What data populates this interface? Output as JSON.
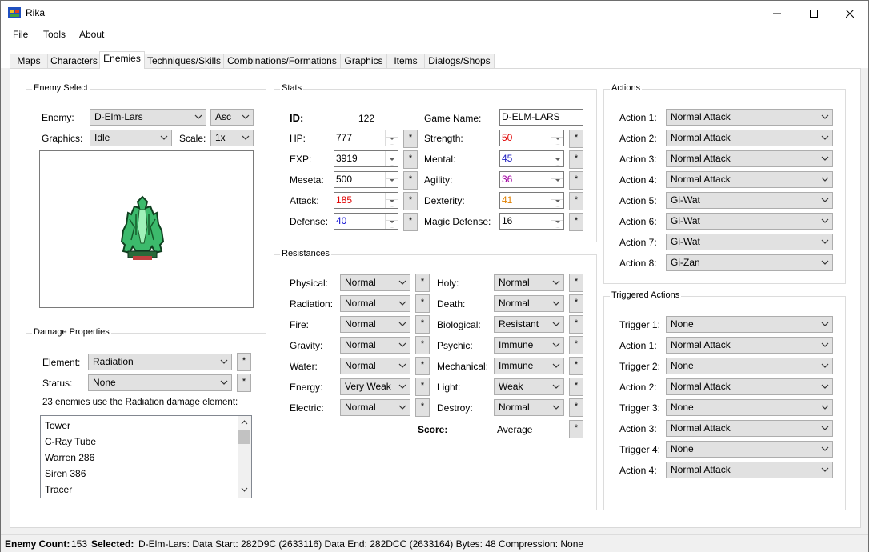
{
  "window": {
    "title": "Rika"
  },
  "menu": [
    "File",
    "Tools",
    "About"
  ],
  "tabs": [
    "Maps",
    "Characters",
    "Enemies",
    "Techniques/Skills",
    "Combinations/Formations",
    "Graphics",
    "Items",
    "Dialogs/Shops"
  ],
  "active_tab": "Enemies",
  "enemy_select": {
    "title": "Enemy Select",
    "enemy_label": "Enemy:",
    "enemy_value": "D-Elm-Lars",
    "sort_value": "Asc",
    "graphics_label": "Graphics:",
    "graphics_value": "Idle",
    "scale_label": "Scale:",
    "scale_value": "1x"
  },
  "damage": {
    "title": "Damage Properties",
    "element_label": "Element:",
    "element_value": "Radiation",
    "status_label": "Status:",
    "status_value": "None",
    "info": "23 enemies use the Radiation damage element:",
    "list": [
      "Tower",
      "C-Ray Tube",
      "Warren 286",
      "Siren 386",
      "Tracer"
    ]
  },
  "stats": {
    "title": "Stats",
    "id_label": "ID:",
    "id_value": "122",
    "game_name_label": "Game Name:",
    "game_name_value": "D-ELM-LARS",
    "left": [
      {
        "label": "HP:",
        "value": "777",
        "color": "#000000"
      },
      {
        "label": "EXP:",
        "value": "3919",
        "color": "#000000"
      },
      {
        "label": "Meseta:",
        "value": "500",
        "color": "#000000"
      },
      {
        "label": "Attack:",
        "value": "185",
        "color": "#e00000"
      },
      {
        "label": "Defense:",
        "value": "40",
        "color": "#0000d0"
      }
    ],
    "right": [
      {
        "label": "Strength:",
        "value": "50",
        "color": "#e00000"
      },
      {
        "label": "Mental:",
        "value": "45",
        "color": "#2020c0"
      },
      {
        "label": "Agility:",
        "value": "36",
        "color": "#a000a0"
      },
      {
        "label": "Dexterity:",
        "value": "41",
        "color": "#e08000"
      },
      {
        "label": "Magic Defense:",
        "value": "16",
        "color": "#000000"
      }
    ],
    "star": "*"
  },
  "resistances": {
    "title": "Resistances",
    "left": [
      {
        "label": "Physical:",
        "value": "Normal"
      },
      {
        "label": "Radiation:",
        "value": "Normal"
      },
      {
        "label": "Fire:",
        "value": "Normal"
      },
      {
        "label": "Gravity:",
        "value": "Normal"
      },
      {
        "label": "Water:",
        "value": "Normal"
      },
      {
        "label": "Energy:",
        "value": "Very Weak"
      },
      {
        "label": "Electric:",
        "value": "Normal"
      }
    ],
    "right": [
      {
        "label": "Holy:",
        "value": "Normal"
      },
      {
        "label": "Death:",
        "value": "Normal"
      },
      {
        "label": "Biological:",
        "value": "Resistant"
      },
      {
        "label": "Psychic:",
        "value": "Immune"
      },
      {
        "label": "Mechanical:",
        "value": "Immune"
      },
      {
        "label": "Light:",
        "value": "Weak"
      },
      {
        "label": "Destroy:",
        "value": "Normal"
      }
    ],
    "score_label": "Score:",
    "score_value": "Average"
  },
  "actions": {
    "title": "Actions",
    "items": [
      {
        "label": "Action 1:",
        "value": "Normal Attack"
      },
      {
        "label": "Action 2:",
        "value": "Normal Attack"
      },
      {
        "label": "Action 3:",
        "value": "Normal Attack"
      },
      {
        "label": "Action 4:",
        "value": "Normal Attack"
      },
      {
        "label": "Action 5:",
        "value": "Gi-Wat"
      },
      {
        "label": "Action 6:",
        "value": "Gi-Wat"
      },
      {
        "label": "Action 7:",
        "value": "Gi-Wat"
      },
      {
        "label": "Action 8:",
        "value": "Gi-Zan"
      }
    ]
  },
  "triggered": {
    "title": "Triggered Actions",
    "items": [
      {
        "label": "Trigger 1:",
        "value": "None"
      },
      {
        "label": "Action 1:",
        "value": "Normal Attack"
      },
      {
        "label": "Trigger 2:",
        "value": "None"
      },
      {
        "label": "Action 2:",
        "value": "Normal Attack"
      },
      {
        "label": "Trigger 3:",
        "value": "None"
      },
      {
        "label": "Action 3:",
        "value": "Normal Attack"
      },
      {
        "label": "Trigger 4:",
        "value": "None"
      },
      {
        "label": "Action 4:",
        "value": "Normal Attack"
      }
    ]
  },
  "status_bar": {
    "count_label": "Enemy Count:",
    "count_value": "153",
    "selected_label": "Selected:",
    "selected_value": "D-Elm-Lars: Data Start: 282D9C (2633116) Data End: 282DCC (2633164) Bytes: 48 Compression: None"
  }
}
